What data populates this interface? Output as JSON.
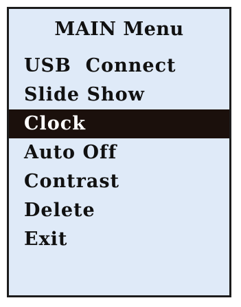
{
  "menu": {
    "title": "MAIN Menu",
    "selected_index": 2,
    "items": [
      {
        "label": "USB  Connect",
        "name": "menu-item-usb-connect"
      },
      {
        "label": "Slide Show",
        "name": "menu-item-slide-show"
      },
      {
        "label": "Clock",
        "name": "menu-item-clock"
      },
      {
        "label": "Auto Off",
        "name": "menu-item-auto-off"
      },
      {
        "label": "Contrast",
        "name": "menu-item-contrast"
      },
      {
        "label": "Delete",
        "name": "menu-item-delete"
      },
      {
        "label": "Exit",
        "name": "menu-item-exit"
      }
    ]
  },
  "colors": {
    "screen_background": "#dfeaf8",
    "highlight_background": "#1b100c",
    "highlight_text": "#ffffff",
    "text": "#111111",
    "border": "#1c1c1c"
  }
}
